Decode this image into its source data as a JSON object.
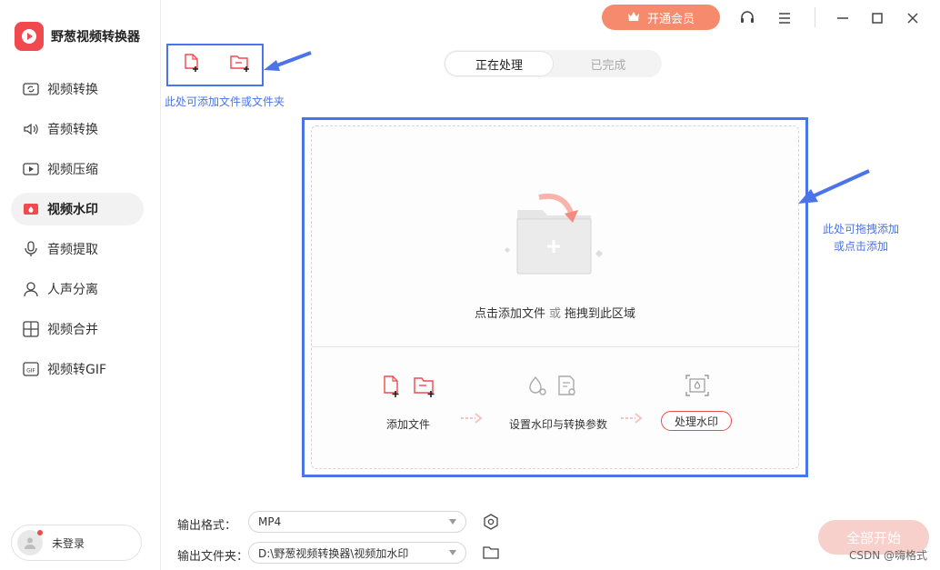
{
  "app": {
    "name": "野葱视频转换器"
  },
  "sidebar": {
    "items": [
      {
        "label": "视频转换",
        "icon": "video-convert-icon",
        "active": false
      },
      {
        "label": "音频转换",
        "icon": "audio-convert-icon",
        "active": false
      },
      {
        "label": "视频压缩",
        "icon": "video-compress-icon",
        "active": false
      },
      {
        "label": "视频水印",
        "icon": "video-watermark-icon",
        "active": true
      },
      {
        "label": "音频提取",
        "icon": "audio-extract-icon",
        "active": false
      },
      {
        "label": "人声分离",
        "icon": "vocal-separate-icon",
        "active": false
      },
      {
        "label": "视频合并",
        "icon": "video-merge-icon",
        "active": false
      },
      {
        "label": "视频转GIF",
        "icon": "gif-icon",
        "active": false
      }
    ],
    "user_label": "未登录"
  },
  "titlebar": {
    "vip_label": "开通会员"
  },
  "tabs": [
    {
      "label": "正在处理",
      "active": true
    },
    {
      "label": "已完成",
      "active": false
    }
  ],
  "annotations": {
    "add_hint": "此处可添加文件或文件夹",
    "drop_hint_line1": "此处可拖拽添加",
    "drop_hint_line2": "或点击添加"
  },
  "dropzone": {
    "text_main": "点击添加文件",
    "text_or": "或",
    "text_drag": "拖拽到此区域",
    "steps": [
      "添加文件",
      "设置水印与转换参数",
      "处理水印"
    ]
  },
  "output": {
    "format_label": "输出格式：",
    "format_value": "MP4",
    "folder_label": "输出文件夹：",
    "folder_value": "D:\\野葱视频转换器\\视频加水印"
  },
  "start_label": "全部开始",
  "watermark": "CSDN @嗨格式",
  "colors": {
    "brand": "#f0494e",
    "vip": "#f58a6d",
    "annotation": "#4a74e8",
    "start_disabled": "#f7d0cc"
  }
}
